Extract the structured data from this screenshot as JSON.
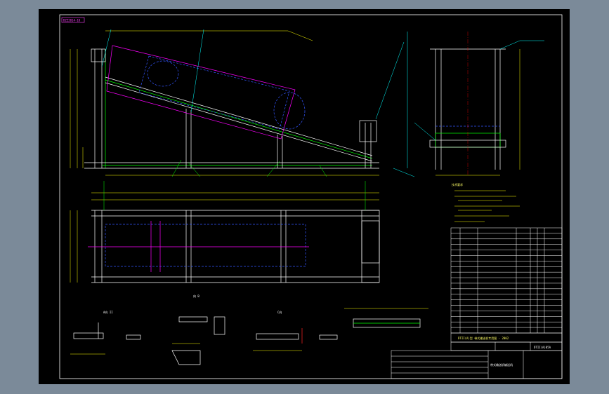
{
  "drawing": {
    "top_left_tag": "DZZ2014-10",
    "main_title": "DTII(A)型  带式输送机专用图 - 2002",
    "bottom_company": "带式输送机输送机",
    "tech_notes_title": "技术要求",
    "section_labels": [
      "A向  II",
      "向  B",
      "C向"
    ],
    "cad_number": "DTII(A)05A",
    "colors": {
      "background": "#000000",
      "frame": "#ffffff",
      "structure": "#00ff00",
      "hidden": "#3355ff",
      "belt_outline": "#ff00ff",
      "dimension": "#ffff00",
      "leader": "#00ffff",
      "cut_mark": "#ff2222",
      "outer": "#7b8a99"
    }
  }
}
